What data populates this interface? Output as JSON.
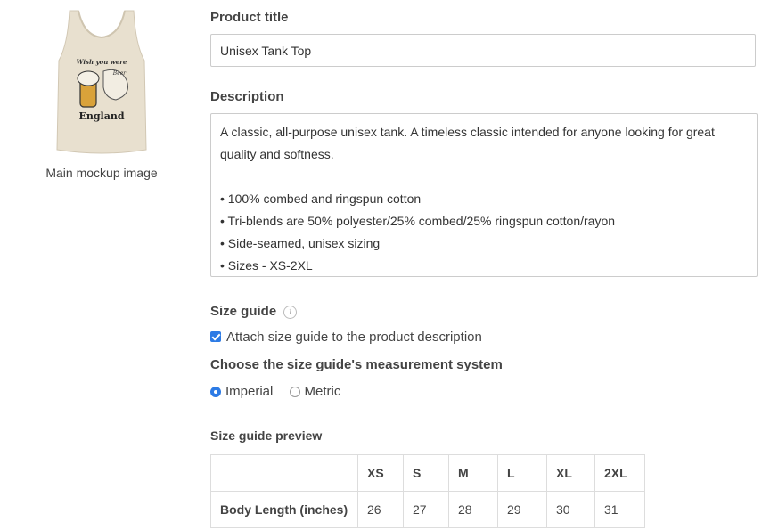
{
  "mockup": {
    "caption": "Main mockup image",
    "print_text_top": "Wish you were",
    "print_text_beer": "Beer",
    "print_text_bottom": "England",
    "garment_color": "#e8e0cf"
  },
  "form": {
    "title_label": "Product title",
    "title_value": "Unisex Tank Top",
    "description_label": "Description",
    "description_lines": [
      "A classic, all-purpose unisex tank. A timeless classic intended for anyone looking for great quality and softness.",
      "",
      "• 100% combed and ringspun cotton",
      "• Tri-blends are 50% polyester/25% combed/25% ringspun cotton/rayon",
      "• Side-seamed, unisex sizing",
      "• Sizes - XS-2XL"
    ],
    "size_guide_label": "Size guide",
    "info_icon": "i",
    "attach_checkbox_label": "Attach size guide to the product description",
    "attach_checked": true,
    "measurement_label": "Choose the size guide's measurement system",
    "measurement_options": [
      "Imperial",
      "Metric"
    ],
    "measurement_selected": "Imperial",
    "preview_label": "Size guide preview"
  },
  "size_table": {
    "headers": [
      "",
      "XS",
      "S",
      "M",
      "L",
      "XL",
      "2XL"
    ],
    "row_label": "Body Length (inches)",
    "values": [
      "26",
      "27",
      "28",
      "29",
      "30",
      "31"
    ]
  },
  "colors": {
    "accent": "#2d7be5",
    "border": "#cccccc"
  }
}
